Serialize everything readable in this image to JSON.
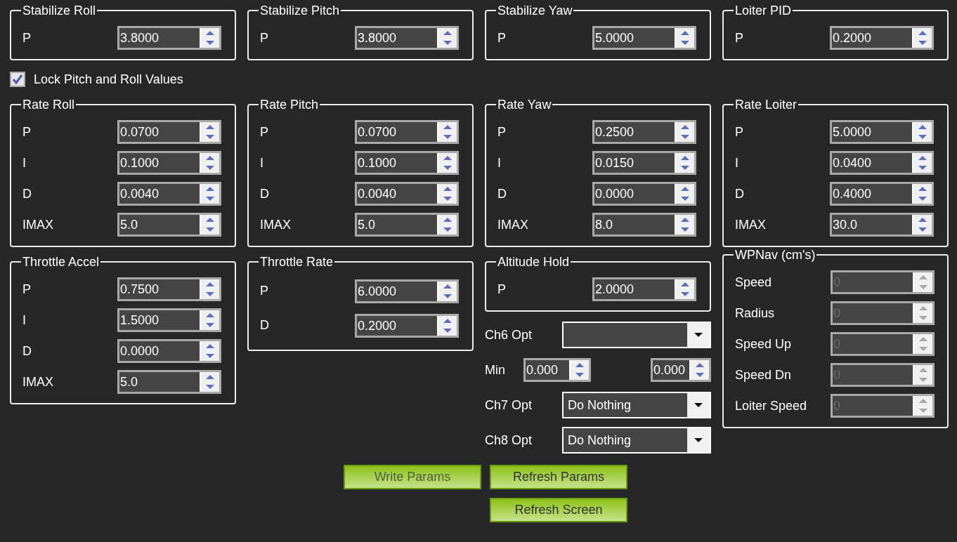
{
  "top_groups": [
    {
      "title": "Stabilize Roll",
      "fields": [
        {
          "label": "P",
          "value": "3.8000"
        }
      ]
    },
    {
      "title": "Stabilize Pitch",
      "fields": [
        {
          "label": "P",
          "value": "3.8000"
        }
      ]
    },
    {
      "title": "Stabilize Yaw",
      "fields": [
        {
          "label": "P",
          "value": "5.0000"
        }
      ]
    },
    {
      "title": "Loiter PID",
      "fields": [
        {
          "label": "P",
          "value": "0.2000"
        }
      ]
    }
  ],
  "lock_checkbox": {
    "label": "Lock Pitch and Roll Values",
    "checked": true
  },
  "rate_groups": [
    {
      "title": "Rate Roll",
      "fields": [
        {
          "label": "P",
          "value": "0.0700"
        },
        {
          "label": "I",
          "value": "0.1000"
        },
        {
          "label": "D",
          "value": "0.0040"
        },
        {
          "label": "IMAX",
          "value": "5.0"
        }
      ]
    },
    {
      "title": "Rate Pitch",
      "fields": [
        {
          "label": "P",
          "value": "0.0700"
        },
        {
          "label": "I",
          "value": "0.1000"
        },
        {
          "label": "D",
          "value": "0.0040"
        },
        {
          "label": "IMAX",
          "value": "5.0"
        }
      ]
    },
    {
      "title": "Rate Yaw",
      "fields": [
        {
          "label": "P",
          "value": "0.2500"
        },
        {
          "label": "I",
          "value": "0.0150"
        },
        {
          "label": "D",
          "value": "0.0000"
        },
        {
          "label": "IMAX",
          "value": "8.0"
        }
      ]
    },
    {
      "title": "Rate Loiter",
      "fields": [
        {
          "label": "P",
          "value": "5.0000"
        },
        {
          "label": "I",
          "value": "0.0400"
        },
        {
          "label": "D",
          "value": "0.4000"
        },
        {
          "label": "IMAX",
          "value": "30.0"
        }
      ]
    }
  ],
  "throttle_accel": {
    "title": "Throttle Accel",
    "fields": [
      {
        "label": "P",
        "value": "0.7500"
      },
      {
        "label": "I",
        "value": "1.5000"
      },
      {
        "label": "D",
        "value": "0.0000"
      },
      {
        "label": "IMAX",
        "value": "5.0"
      }
    ]
  },
  "throttle_rate": {
    "title": "Throttle Rate",
    "fields": [
      {
        "label": "P",
        "value": "6.0000"
      },
      {
        "label": "D",
        "value": "0.2000"
      }
    ]
  },
  "altitude_hold": {
    "title": "Altitude Hold",
    "fields": [
      {
        "label": "P",
        "value": "2.0000"
      }
    ]
  },
  "ch6_option": {
    "label": "Ch6 Opt"
  },
  "ch6_range": {
    "label": "Min",
    "values": [
      "0.000",
      "0.000"
    ]
  },
  "channel_options": [
    {
      "label": "Ch7 Opt",
      "value": "Do Nothing"
    },
    {
      "label": "Ch8 Opt",
      "value": "Do Nothing"
    }
  ],
  "wpnav": {
    "title": "WPNav (cm's)",
    "fields": [
      {
        "label": "Speed",
        "value": "0",
        "disabled": true
      },
      {
        "label": "Radius",
        "value": "0",
        "disabled": true
      },
      {
        "label": "Speed Up",
        "value": "0",
        "disabled": true
      },
      {
        "label": "Speed Dn",
        "value": "0",
        "disabled": true
      },
      {
        "label": "Loiter Speed",
        "value": "0",
        "disabled": true
      }
    ]
  },
  "buttons": [
    {
      "label": "Write Params",
      "disabled": true
    },
    {
      "label": "Refresh Params",
      "disabled": false
    },
    {
      "label": "Refresh Screen",
      "disabled": false
    }
  ]
}
